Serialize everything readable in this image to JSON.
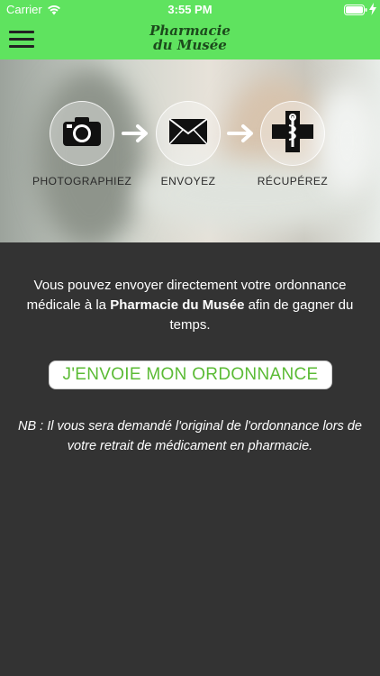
{
  "status_bar": {
    "carrier": "Carrier",
    "time": "3:55 PM",
    "icons": [
      "wifi-icon",
      "battery-icon",
      "charging-icon"
    ]
  },
  "header": {
    "logo_line1": "Pharmacie",
    "logo_line2": "du Musée",
    "menu_icon": "hamburger-menu-icon",
    "background_color": "#5fe35f"
  },
  "steps": [
    {
      "label": "PHOTOGRAPHIEZ",
      "icon": "camera-icon"
    },
    {
      "label": "ENVOYEZ",
      "icon": "envelope-icon"
    },
    {
      "label": "RÉCUPÉREZ",
      "icon": "pharmacy-cross-icon"
    }
  ],
  "intro": {
    "before": "Vous pouvez envoyer directement votre ordonnance médicale à la ",
    "bold": "Pharmacie du Musée",
    "after": " afin de gagner du temps."
  },
  "cta_button": {
    "label": "J'ENVOIE MON ORDONNANCE",
    "color": "#5bbb35"
  },
  "note": "NB : Il vous sera demandé l'original de l'ordonnance lors de votre retrait de médicament en pharmacie."
}
